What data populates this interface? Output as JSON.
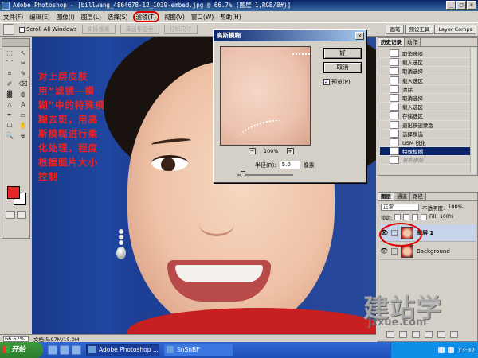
{
  "window": {
    "title": "Adobe Photoshop - [billwang_4864678-12_1039-embed.jpg @ 66.7% (图层 1,RGB/8#)]",
    "controls": [
      "_",
      "□",
      "×"
    ]
  },
  "menu": {
    "items": [
      "文件(F)",
      "编辑(E)",
      "图像(I)",
      "图层(L)",
      "选择(S)",
      "滤镜(T)",
      "视图(V)",
      "窗口(W)",
      "帮助(H)"
    ],
    "highlighted_index": 5
  },
  "options": {
    "scroll_all_windows": "Scroll All Windows",
    "disabled_buttons": [
      "实际像素",
      "满画布显示",
      "打印尺寸"
    ],
    "panel_tabs": [
      "画笔",
      "预设工具",
      "Layer Comps"
    ]
  },
  "overlay_text": "对上层皮肤用“滤镜—模糊”中的特殊模糊去斑，用高斯模糊进行柔化处理，程度根据图片大小控制",
  "toolbox": {
    "glyphs": [
      "⬚",
      "↖",
      "⌒",
      "✂",
      "⌗",
      "✎",
      "✐",
      "⌫",
      "▓",
      "◍",
      "△",
      "A",
      "✒",
      "▭",
      "☐",
      "✋",
      "🔍",
      "⊕"
    ],
    "colors": {
      "foreground": "#e82828",
      "background": "#ffffff"
    }
  },
  "dialog": {
    "title": "高斯模糊",
    "ok": "好",
    "cancel": "取消",
    "preview_label": "预览(P)",
    "preview_checked": true,
    "zoom_minus": "−",
    "zoom_plus": "+",
    "zoom": "100%",
    "radius_label": "半径(R):",
    "radius_value": "5.0",
    "radius_unit": "像素",
    "close": "×"
  },
  "history": {
    "tabs": [
      "历史记录",
      "动作"
    ],
    "items": [
      {
        "label": "取消选择",
        "state": "normal"
      },
      {
        "label": "载入选区",
        "state": "normal"
      },
      {
        "label": "取消选择",
        "state": "normal"
      },
      {
        "label": "载入选区",
        "state": "normal"
      },
      {
        "label": "清除",
        "state": "normal"
      },
      {
        "label": "取消选择",
        "state": "normal"
      },
      {
        "label": "载入选区",
        "state": "normal"
      },
      {
        "label": "存储选区",
        "state": "normal"
      },
      {
        "label": "退出快速蒙版",
        "state": "normal"
      },
      {
        "label": "选择反选",
        "state": "normal"
      },
      {
        "label": "USM 锐化",
        "state": "normal"
      },
      {
        "label": "特殊模糊",
        "state": "selected"
      },
      {
        "label": "高斯模糊",
        "state": "undone"
      }
    ]
  },
  "layers": {
    "tabs": [
      "图层",
      "通道",
      "路径"
    ],
    "blend_mode": "正常",
    "opacity_label": "不透明度:",
    "opacity": "100%",
    "lock_label": "锁定:",
    "fill_label": "Fill:",
    "fill": "100%",
    "items": [
      {
        "name": "图层 1",
        "active": true,
        "eye": "👁"
      },
      {
        "name": "Background",
        "active": false,
        "eye": "👁"
      }
    ]
  },
  "status": {
    "zoom": "66.67%",
    "doc": "文档:5.97M/15.0M"
  },
  "watermark": {
    "line1": "建站学",
    "line2": "jzxue.com"
  },
  "taskbar": {
    "start": "开始",
    "tasks": [
      {
        "label": "Adobe Photoshop ...",
        "active": true
      },
      {
        "label": "SnSnBF",
        "active": false
      }
    ],
    "clock": "13:32"
  }
}
